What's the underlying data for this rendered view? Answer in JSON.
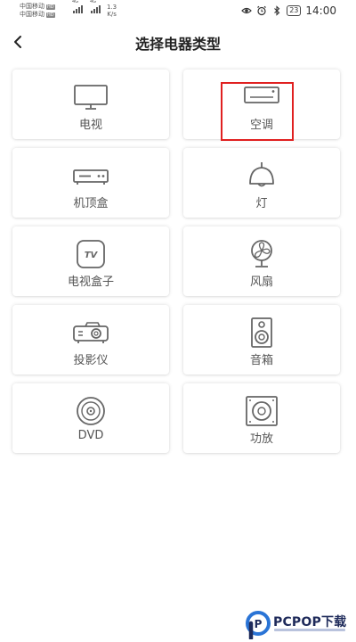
{
  "status_bar": {
    "carrier_1": "中国移动",
    "carrier_2": "中国移动",
    "hd_badge": "HD",
    "net_1": "4G",
    "net_2": "4G",
    "speed_value": "1.3",
    "speed_unit": "K/s",
    "battery": "23",
    "time": "14:00"
  },
  "header": {
    "title": "选择电器类型"
  },
  "devices": [
    {
      "label": "电视",
      "icon": "tv-icon"
    },
    {
      "label": "空调",
      "icon": "air-conditioner-icon"
    },
    {
      "label": "机顶盒",
      "icon": "set-top-box-icon"
    },
    {
      "label": "灯",
      "icon": "lamp-icon"
    },
    {
      "label": "电视盒子",
      "icon": "tv-box-icon"
    },
    {
      "label": "风扇",
      "icon": "fan-icon"
    },
    {
      "label": "投影仪",
      "icon": "projector-icon"
    },
    {
      "label": "音箱",
      "icon": "speaker-icon"
    },
    {
      "label": "DVD",
      "icon": "dvd-icon"
    },
    {
      "label": "功放",
      "icon": "amplifier-icon"
    }
  ],
  "tv_box_icon_text": "TV",
  "highlighted_device": "空调",
  "colors": {
    "highlight": "#e02020",
    "icon_stroke": "#666666",
    "label": "#555555"
  },
  "watermark": {
    "text": "PCPOP下载",
    "logo_letter": "P"
  }
}
